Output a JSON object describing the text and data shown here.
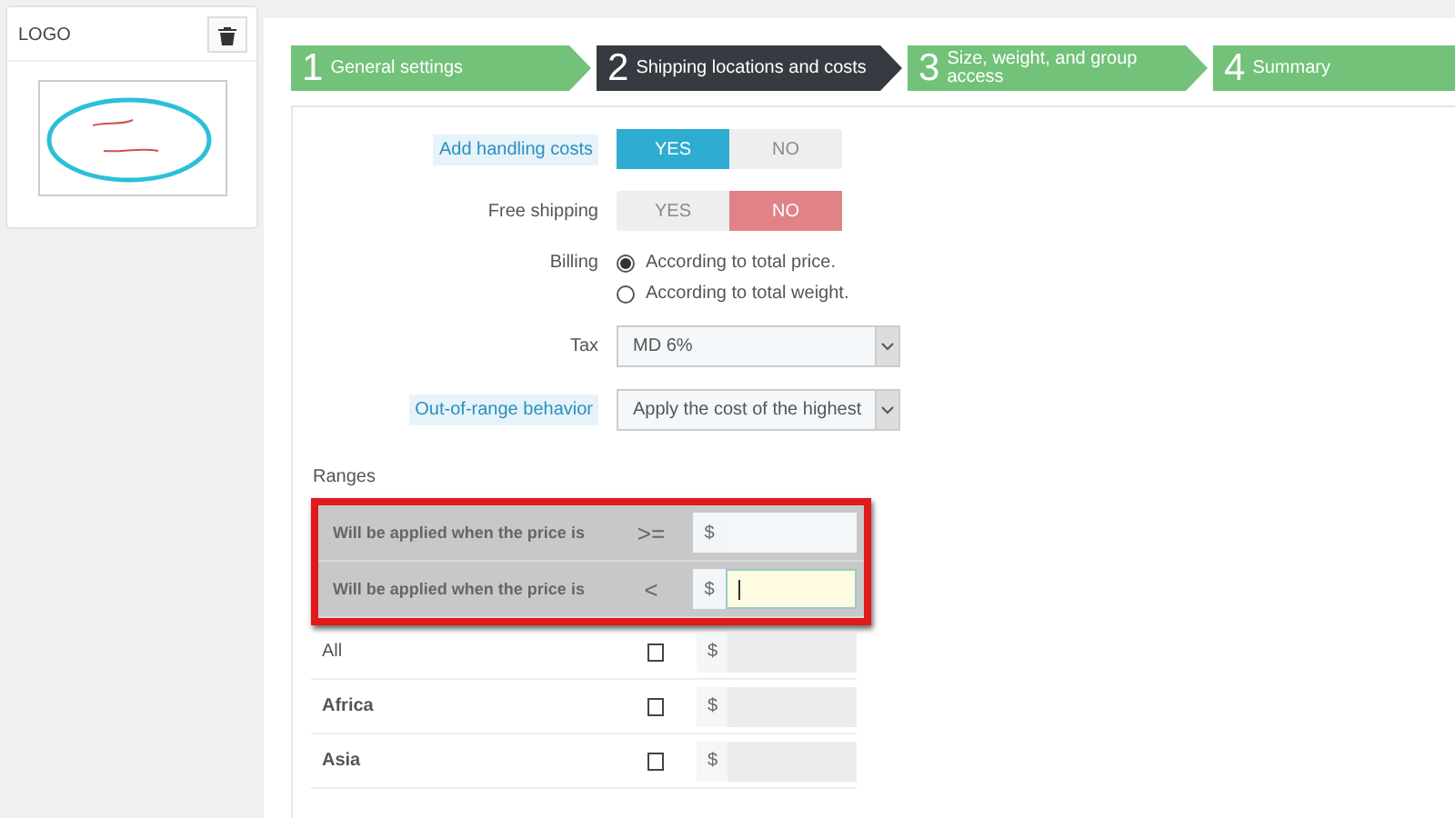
{
  "logo_panel": {
    "title": "LOGO"
  },
  "steps": [
    {
      "number": "1",
      "label": "General settings",
      "selected": false
    },
    {
      "number": "2",
      "label": "Shipping locations and costs",
      "selected": true
    },
    {
      "number": "3",
      "label": "Size, weight, and group access",
      "selected": false
    },
    {
      "number": "4",
      "label": "Summary",
      "selected": false
    }
  ],
  "toggles": [
    {
      "label": "Add handling costs",
      "has_help": true,
      "options": [
        {
          "label": "YES",
          "selected": true,
          "kind": "yes"
        },
        {
          "label": "NO",
          "selected": false,
          "kind": "no"
        }
      ]
    },
    {
      "label": "Free shipping",
      "has_help": false,
      "options": [
        {
          "label": "YES",
          "selected": false,
          "kind": "yes"
        },
        {
          "label": "NO",
          "selected": true,
          "kind": "no"
        }
      ]
    }
  ],
  "billing": {
    "label": "Billing",
    "options": [
      {
        "label": "According to total price.",
        "selected": true
      },
      {
        "label": "According to total weight.",
        "selected": false
      }
    ]
  },
  "selects": [
    {
      "label": "Tax",
      "has_help": false,
      "value": "MD 6%"
    },
    {
      "label": "Out-of-range behavior",
      "has_help": true,
      "value": "Apply the cost of the highest"
    }
  ],
  "ranges": {
    "title": "Ranges",
    "limits": [
      {
        "label": "Will be applied when the price is",
        "operator": ">=",
        "currency": "$",
        "focused": false
      },
      {
        "label": "Will be applied when the price is",
        "operator": "<",
        "currency": "$",
        "focused": true
      }
    ],
    "zones": [
      {
        "name": "All",
        "kind": "all",
        "checked": false,
        "currency": "$"
      },
      {
        "name": "Africa",
        "kind": "zone",
        "checked": false,
        "currency": "$"
      },
      {
        "name": "Asia",
        "kind": "zone",
        "checked": false,
        "currency": "$"
      }
    ]
  }
}
